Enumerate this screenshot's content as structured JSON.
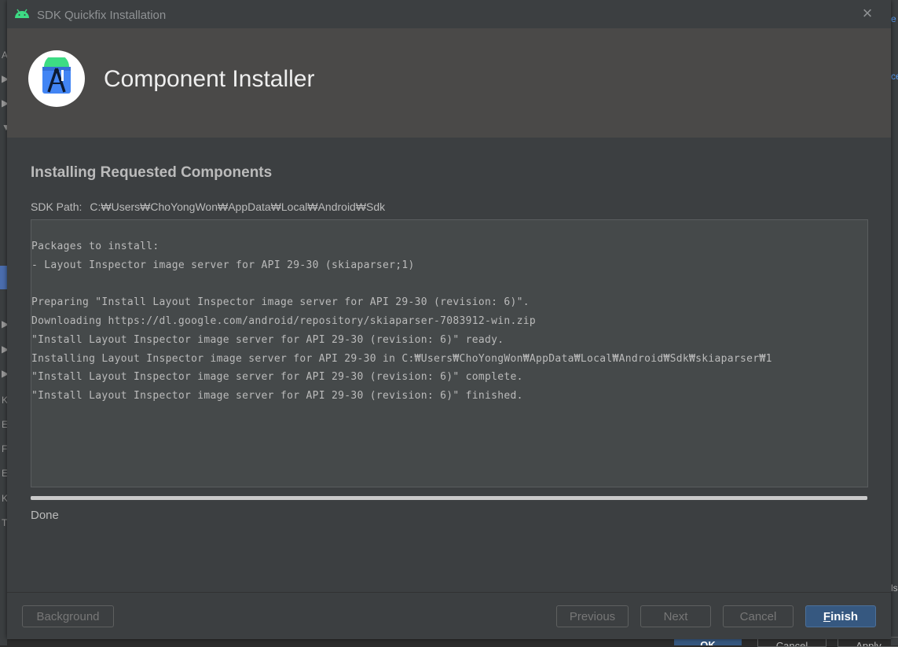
{
  "window": {
    "title": "SDK Quickfix Installation",
    "close_glyph": "×"
  },
  "header": {
    "title": "Component Installer"
  },
  "content": {
    "section_title": "Installing Requested Components",
    "sdk_path_label": "SDK Path:",
    "sdk_path_value": "C:₩Users₩ChoYongWon₩AppData₩Local₩Android₩Sdk",
    "log_lines": [
      "Packages to install:",
      "- Layout Inspector image server for API 29-30 (skiaparser;1)",
      "",
      "Preparing \"Install Layout Inspector image server for API 29-30 (revision: 6)\".",
      "Downloading https://dl.google.com/android/repository/skiaparser-7083912-win.zip",
      "\"Install Layout Inspector image server for API 29-30 (revision: 6)\" ready.",
      "Installing Layout Inspector image server for API 29-30 in C:₩Users₩ChoYongWon₩AppData₩Local₩Android₩Sdk₩skiaparser₩1",
      "\"Install Layout Inspector image server for API 29-30 (revision: 6)\" complete.",
      "\"Install Layout Inspector image server for API 29-30 (revision: 6)\" finished."
    ],
    "progress_fraction": 1.0,
    "status": "Done"
  },
  "footer": {
    "background_label": "Background",
    "previous_label": "Previous",
    "next_label": "Next",
    "cancel_label": "Cancel",
    "finish_mnemonic": "F",
    "finish_rest": "inish"
  },
  "background_ide": {
    "ok_label": "OK",
    "cancel_label": "Cancel",
    "apply_label": "Apply",
    "left_marks": [
      "A",
      "▶",
      "▶",
      "▼",
      "▶",
      "▶",
      "▶",
      "K",
      "E",
      "F",
      "E",
      "K",
      "T"
    ],
    "right_marks": [
      "e",
      "ce",
      "ls"
    ]
  },
  "colors": {
    "dialog_bg": "#3c3f41",
    "header_bg": "#4a4948",
    "log_bg": "#45494a",
    "accent": "#365880",
    "android_green": "#3ddc84",
    "studio_blue": "#4285f4"
  }
}
